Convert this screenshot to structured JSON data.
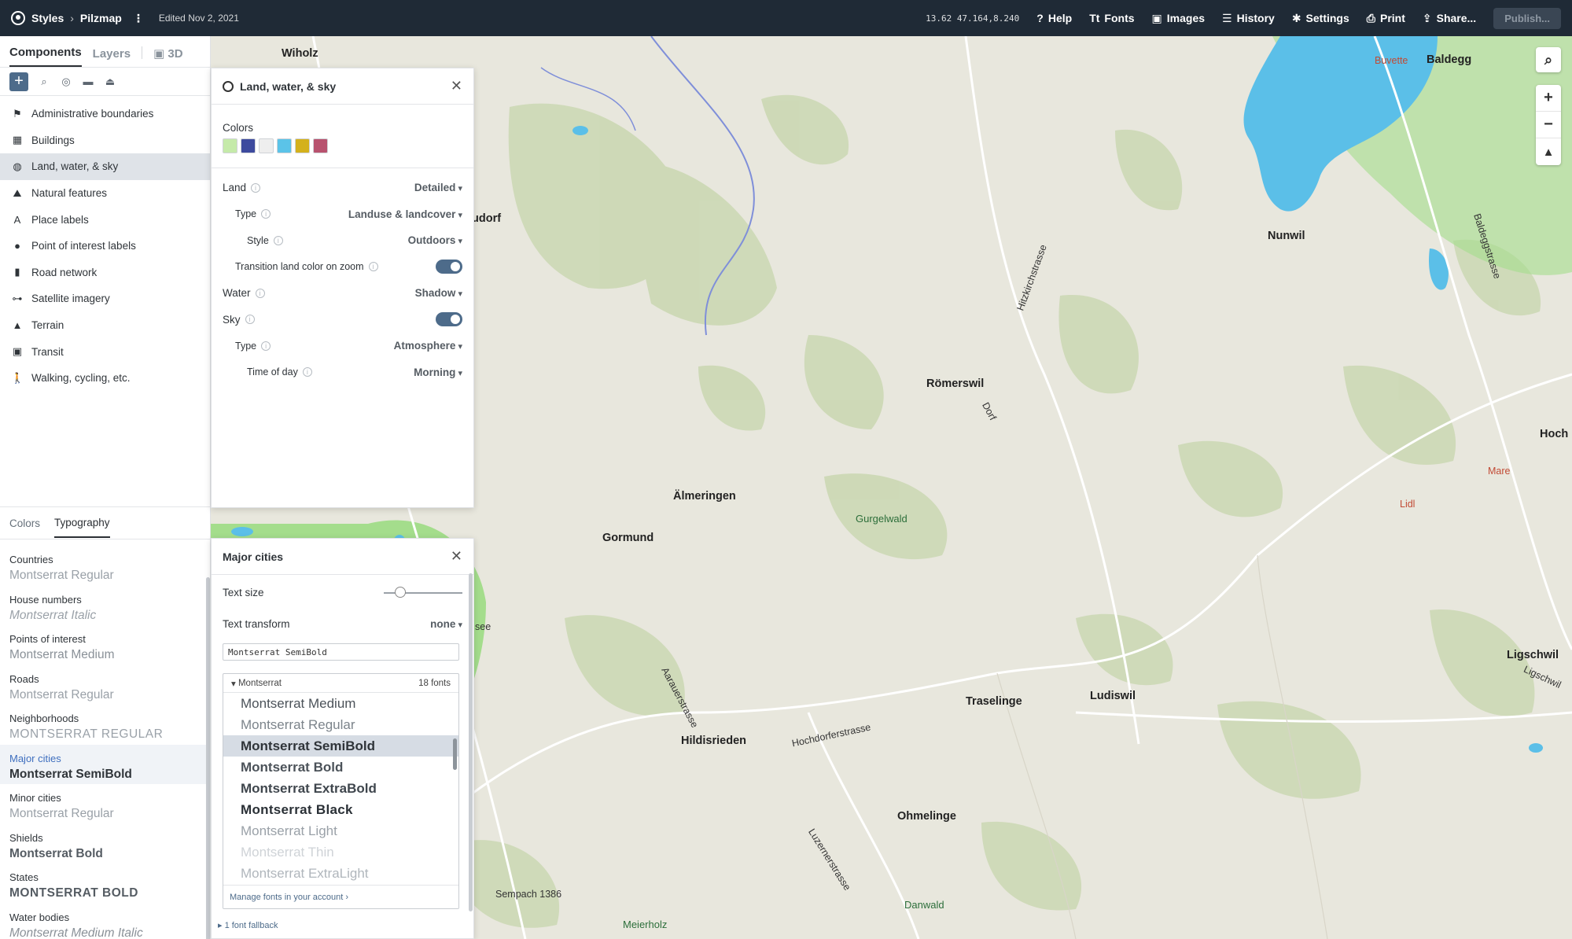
{
  "topbar": {
    "app": "Styles",
    "project": "Pilzmap",
    "edited": "Edited Nov 2, 2021",
    "coords": "13.62  47.164,8.240",
    "help": "Help",
    "fonts": "Fonts",
    "images": "Images",
    "history": "History",
    "settings": "Settings",
    "print": "Print",
    "share": "Share...",
    "publish": "Publish..."
  },
  "sidebar": {
    "tabs": [
      "Components",
      "Layers",
      "3D"
    ],
    "components": [
      {
        "label": "Administrative boundaries",
        "icon": "flag-icon",
        "glyph": "⚑"
      },
      {
        "label": "Buildings",
        "icon": "building-icon",
        "glyph": "▦"
      },
      {
        "label": "Land, water, & sky",
        "icon": "globe-icon",
        "glyph": "◍"
      },
      {
        "label": "Natural features",
        "icon": "mountain-icon",
        "glyph": "⛰"
      },
      {
        "label": "Place labels",
        "icon": "place-label-icon",
        "glyph": "A"
      },
      {
        "label": "Point of interest labels",
        "icon": "pin-icon",
        "glyph": "●"
      },
      {
        "label": "Road network",
        "icon": "road-icon",
        "glyph": "▮"
      },
      {
        "label": "Satellite imagery",
        "icon": "satellite-icon",
        "glyph": "⊶"
      },
      {
        "label": "Terrain",
        "icon": "terrain-icon",
        "glyph": "▲"
      },
      {
        "label": "Transit",
        "icon": "transit-icon",
        "glyph": "▣"
      },
      {
        "label": "Walking, cycling, etc.",
        "icon": "walking-icon",
        "glyph": "🚶"
      }
    ],
    "lower_tabs": [
      "Colors",
      "Typography"
    ],
    "typography": [
      {
        "label": "Countries",
        "font": "Montserrat Regular"
      },
      {
        "label": "House numbers",
        "font": "Montserrat Italic"
      },
      {
        "label": "Points of interest",
        "font": "Montserrat Medium"
      },
      {
        "label": "Roads",
        "font": "Montserrat Regular"
      },
      {
        "label": "Neighborhoods",
        "font": "MONTSERRAT REGULAR"
      },
      {
        "label": "Major cities",
        "font": "Montserrat SemiBold"
      },
      {
        "label": "Minor cities",
        "font": "Montserrat Regular"
      },
      {
        "label": "Shields",
        "font": "Montserrat Bold"
      },
      {
        "label": "States",
        "font": "MONTSERRAT BOLD"
      },
      {
        "label": "Water bodies",
        "font": "Montserrat Medium Italic"
      }
    ]
  },
  "land_panel": {
    "title": "Land, water, & sky",
    "colors_title": "Colors",
    "swatches": [
      "#c5eaa9",
      "#3d4a9e",
      "#eeeeee",
      "#5bc3e8",
      "#d4b11c",
      "#b8526e"
    ],
    "land_label": "Land",
    "land_value": "Detailed",
    "type_label": "Type",
    "type_value": "Landuse & landcover",
    "style_label": "Style",
    "style_value": "Outdoors",
    "transition_label": "Transition land color on zoom",
    "water_label": "Water",
    "water_value": "Shadow",
    "sky_label": "Sky",
    "sky_type_label": "Type",
    "sky_type_value": "Atmosphere",
    "time_label": "Time of day",
    "time_value": "Morning"
  },
  "cities_panel": {
    "title": "Major cities",
    "text_size_label": "Text size",
    "text_transform_label": "Text transform",
    "text_transform_value": "none",
    "font_input_value": "Montserrat SemiBold",
    "family": "Montserrat",
    "count": "18 fonts",
    "fonts": [
      "Montserrat Medium",
      "Montserrat Regular",
      "Montserrat SemiBold",
      "Montserrat Bold",
      "Montserrat ExtraBold",
      "Montserrat Black",
      "Montserrat Light",
      "Montserrat Thin",
      "Montserrat ExtraLight"
    ],
    "manage": "Manage fonts in your account",
    "fallback": "1 font fallback"
  },
  "map": {
    "places": [
      {
        "name": "Wiholz"
      },
      {
        "name": "Baldegg"
      },
      {
        "name": "Nunwil"
      },
      {
        "name": "Römerswil"
      },
      {
        "name": "Hoch"
      },
      {
        "name": "Älmeringen"
      },
      {
        "name": "Gormund"
      },
      {
        "name": "Traselinge"
      },
      {
        "name": "Ludiswil"
      },
      {
        "name": "Ligschwil"
      },
      {
        "name": "Hildisrieden"
      },
      {
        "name": "Ohmelinge"
      },
      {
        "name": "udorf"
      }
    ],
    "nature": [
      "Gurgelwald",
      "Danwald",
      "Meierholz"
    ],
    "pois": [
      "Buvette",
      "Mare",
      "Lidl"
    ],
    "streets": [
      "Hitzkirchstrasse",
      "Baldeggstrasse",
      "Dorf",
      "Aarauerstrasse",
      "Hochdorferstrasse",
      "Luzernerstrasse",
      "Ligschwil"
    ],
    "sempach": "Sempach 1386",
    "see": "see"
  }
}
